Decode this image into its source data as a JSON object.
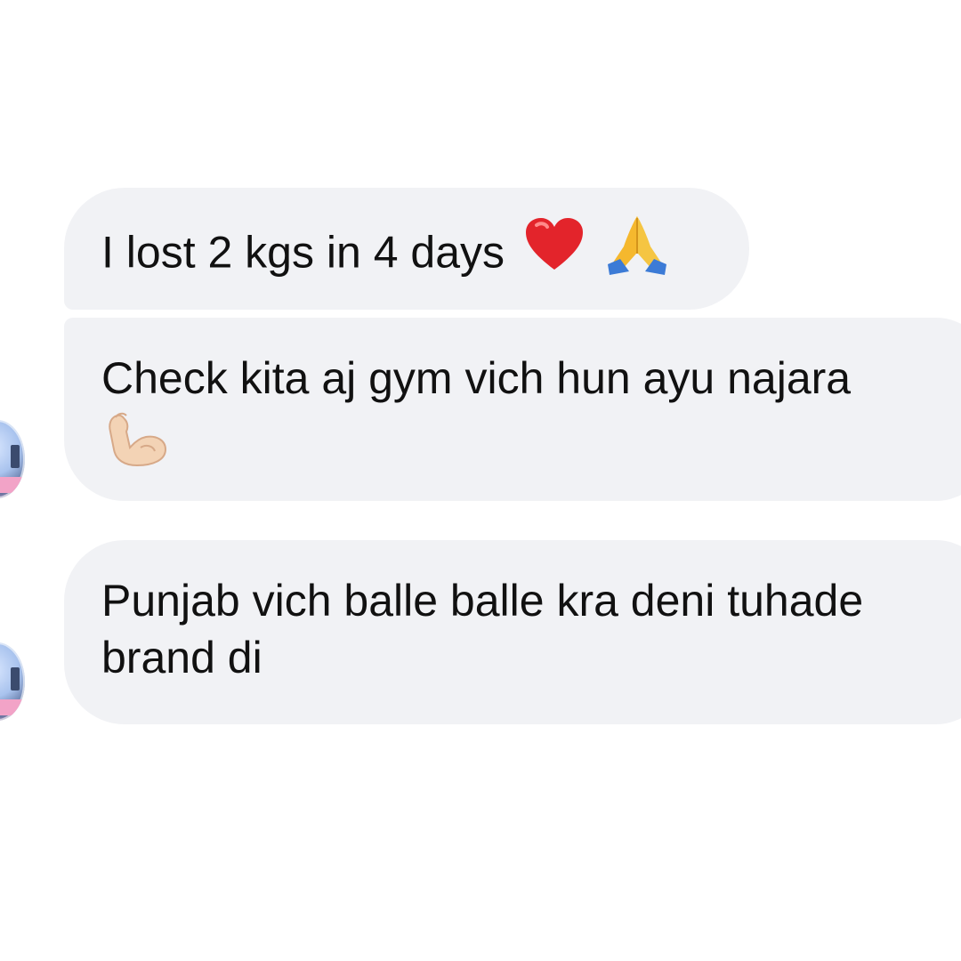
{
  "conversation": {
    "messages": [
      {
        "text": "I lost 2 kgs in 4 days",
        "emoji": [
          "heart-emoji",
          "folded-hands-emoji"
        ]
      },
      {
        "lines": [
          "Check kita aj gym vich hun ayu najara"
        ],
        "emoji": [
          "flexed-biceps-emoji"
        ]
      },
      {
        "lines": [
          "Punjab vich balle balle kra deni tuhade",
          "brand di"
        ]
      }
    ]
  },
  "colors": {
    "bubble_background": "#f1f2f5",
    "text": "#111111",
    "page_background": "#ffffff",
    "heart": "#e3242b",
    "hands": "#f5b82e",
    "sleeve": "#3c7bd6"
  }
}
